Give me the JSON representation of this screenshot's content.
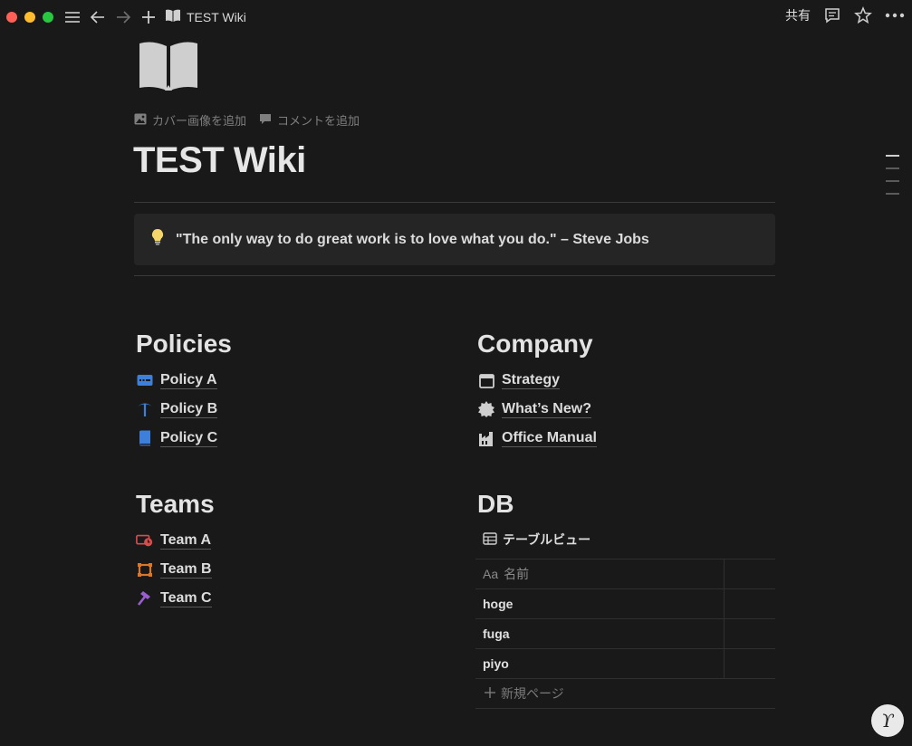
{
  "window": {
    "title": "TEST Wiki"
  },
  "topbar": {
    "share_label": "共有"
  },
  "page": {
    "title": "TEST Wiki",
    "add_cover_label": "カバー画像を追加",
    "add_comment_label": "コメントを追加",
    "quote": "\"The only way to do great work is to love what you do.\" – Steve Jobs"
  },
  "policies": {
    "heading": "Policies",
    "items": [
      {
        "label": "Policy A",
        "icon": "id-card-icon",
        "color": "#3d7fd9"
      },
      {
        "label": "Policy B",
        "icon": "palm-tree-icon",
        "color": "#3d7fd9"
      },
      {
        "label": "Policy C",
        "icon": "book-icon",
        "color": "#3d7fd9"
      }
    ]
  },
  "company": {
    "heading": "Company",
    "items": [
      {
        "label": "Strategy",
        "icon": "calendar-icon"
      },
      {
        "label": "What’s New?",
        "icon": "badge-icon"
      },
      {
        "label": "Office Manual",
        "icon": "factory-icon"
      }
    ]
  },
  "teams": {
    "heading": "Teams",
    "items": [
      {
        "label": "Team A",
        "icon": "money-clock-icon",
        "color": "#d94c4c"
      },
      {
        "label": "Team B",
        "icon": "frame-icon",
        "color": "#d9762a"
      },
      {
        "label": "Team C",
        "icon": "hammer-icon",
        "color": "#9a5fcf"
      }
    ]
  },
  "db": {
    "heading": "DB",
    "view_label": "テーブルビュー",
    "column_name_prefix": "Aa",
    "column_name": "名前",
    "rows": [
      "hoge",
      "fuga",
      "piyo"
    ],
    "new_page_label": "新規ページ"
  },
  "colors": {
    "background": "#191919",
    "callout": "#252525"
  }
}
